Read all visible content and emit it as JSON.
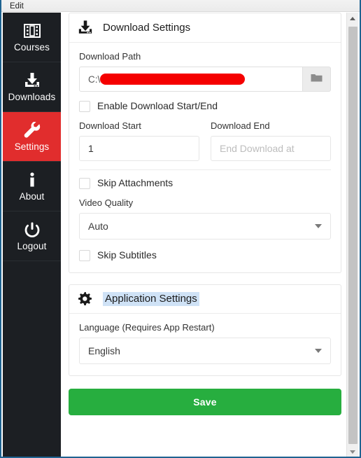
{
  "window": {
    "menubar": {
      "items": [
        "Edit"
      ]
    },
    "accent_blue": "#1f6391"
  },
  "sidebar": {
    "background": "#1c1f23",
    "active_color": "#e12d2d",
    "items": [
      {
        "label": "Courses",
        "icon": "film-icon",
        "active": false
      },
      {
        "label": "Downloads",
        "icon": "download-icon",
        "active": false
      },
      {
        "label": "Settings",
        "icon": "wrench-icon",
        "active": true
      },
      {
        "label": "About",
        "icon": "info-icon",
        "active": false
      },
      {
        "label": "Logout",
        "icon": "power-icon",
        "active": false
      }
    ]
  },
  "download_settings": {
    "title": "Download Settings",
    "icon": "download-icon",
    "download_path": {
      "label": "Download Path",
      "value_prefix": "C:\\",
      "redacted": true,
      "browse_icon": "folder-icon"
    },
    "enable_range": {
      "label": "Enable Download Start/End",
      "checked": false
    },
    "start": {
      "label": "Download Start",
      "value": "1"
    },
    "end": {
      "label": "Download End",
      "value": "",
      "placeholder": "End Download at"
    },
    "skip_attachments": {
      "label": "Skip Attachments",
      "checked": false
    },
    "video_quality": {
      "label": "Video Quality",
      "selected": "Auto"
    },
    "skip_subtitles": {
      "label": "Skip Subtitles",
      "checked": false
    }
  },
  "application_settings": {
    "title": "Application Settings",
    "icon": "gear-icon",
    "title_selected": true,
    "language": {
      "label": "Language (Requires App Restart)",
      "selected": "English"
    }
  },
  "footer": {
    "save_label": "Save",
    "save_color": "#27ae3f"
  },
  "scrollbar": {
    "up_icon": "chevron-up-icon",
    "down_icon": "chevron-down-icon"
  }
}
